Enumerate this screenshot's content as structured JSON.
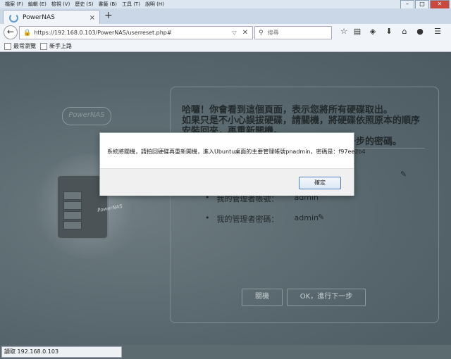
{
  "menu": [
    "檔案 (F)",
    "編輯 (E)",
    "檢視 (V)",
    "歷史 (S)",
    "書籤 (B)",
    "工具 (T)",
    "說明 (H)"
  ],
  "tab": {
    "title": "PowerNAS",
    "close": "×",
    "new": "+"
  },
  "nav": {
    "back": "←",
    "url": "https://192.168.0.103/PowerNAS/userreset.php#",
    "search_placeholder": "搜尋",
    "toolbar_icons": [
      "star-icon",
      "clipboard-icon",
      "pocket-icon",
      "download-icon",
      "home-icon",
      "chat-icon",
      "menu-icon"
    ]
  },
  "bookmarks": [
    "最常瀏覽",
    "新手上路"
  ],
  "page": {
    "logo": "PowerNAS",
    "nas_label": "PowerNAS",
    "message": "哈囉！你會看到這個頁面，表示您將所有硬碟取出。\n如果只是不小心誤拔硬碟，請關機，將硬碟依照原本的順序安裝回來，再重新開機。\n若您是要重置使用者名稱密碼，請點選下一步的密碼。",
    "bullets": [
      {
        "label": "我的管理者帳號：",
        "value": "admin"
      },
      {
        "label": "我的管理者密碼：",
        "value": "admin"
      }
    ],
    "shutdown_button": "關機",
    "next_button": "OK，進行下一步"
  },
  "dialog": {
    "message": "系統將關機，請拍回硬碟再重新開機，進入Ubuntu桌面的主要管理帳號pnadmin，密碼是：f97ee2b4",
    "ok": "確定"
  },
  "status": "讀取 192.168.0.103",
  "colors": {
    "accent": "#4f7fbf",
    "page_bg": "#5c6b70",
    "lock": "#2a9b3c"
  }
}
